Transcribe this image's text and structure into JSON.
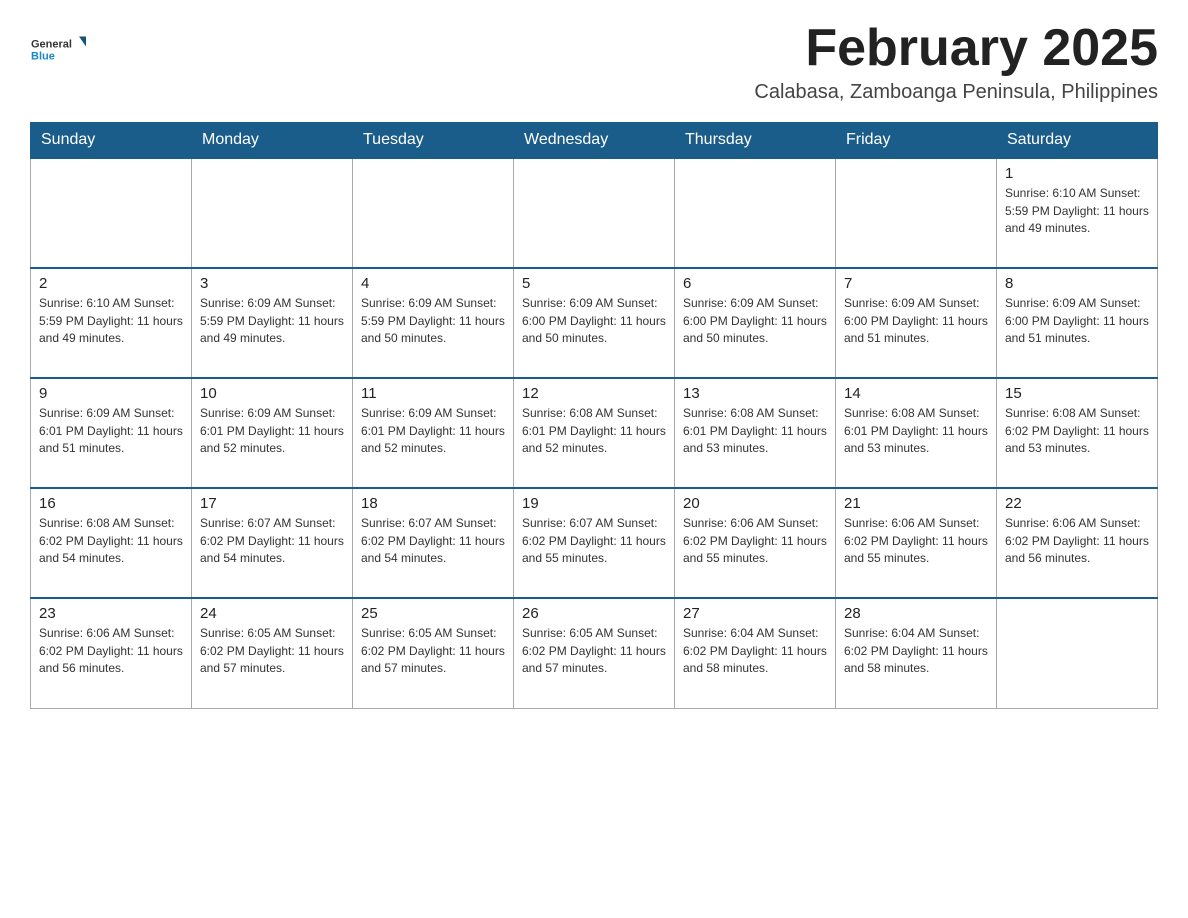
{
  "header": {
    "logo_general": "General",
    "logo_blue": "Blue",
    "title": "February 2025",
    "subtitle": "Calabasa, Zamboanga Peninsula, Philippines"
  },
  "calendar": {
    "days_of_week": [
      "Sunday",
      "Monday",
      "Tuesday",
      "Wednesday",
      "Thursday",
      "Friday",
      "Saturday"
    ],
    "weeks": [
      [
        {
          "day": "",
          "info": ""
        },
        {
          "day": "",
          "info": ""
        },
        {
          "day": "",
          "info": ""
        },
        {
          "day": "",
          "info": ""
        },
        {
          "day": "",
          "info": ""
        },
        {
          "day": "",
          "info": ""
        },
        {
          "day": "1",
          "info": "Sunrise: 6:10 AM\nSunset: 5:59 PM\nDaylight: 11 hours\nand 49 minutes."
        }
      ],
      [
        {
          "day": "2",
          "info": "Sunrise: 6:10 AM\nSunset: 5:59 PM\nDaylight: 11 hours\nand 49 minutes."
        },
        {
          "day": "3",
          "info": "Sunrise: 6:09 AM\nSunset: 5:59 PM\nDaylight: 11 hours\nand 49 minutes."
        },
        {
          "day": "4",
          "info": "Sunrise: 6:09 AM\nSunset: 5:59 PM\nDaylight: 11 hours\nand 50 minutes."
        },
        {
          "day": "5",
          "info": "Sunrise: 6:09 AM\nSunset: 6:00 PM\nDaylight: 11 hours\nand 50 minutes."
        },
        {
          "day": "6",
          "info": "Sunrise: 6:09 AM\nSunset: 6:00 PM\nDaylight: 11 hours\nand 50 minutes."
        },
        {
          "day": "7",
          "info": "Sunrise: 6:09 AM\nSunset: 6:00 PM\nDaylight: 11 hours\nand 51 minutes."
        },
        {
          "day": "8",
          "info": "Sunrise: 6:09 AM\nSunset: 6:00 PM\nDaylight: 11 hours\nand 51 minutes."
        }
      ],
      [
        {
          "day": "9",
          "info": "Sunrise: 6:09 AM\nSunset: 6:01 PM\nDaylight: 11 hours\nand 51 minutes."
        },
        {
          "day": "10",
          "info": "Sunrise: 6:09 AM\nSunset: 6:01 PM\nDaylight: 11 hours\nand 52 minutes."
        },
        {
          "day": "11",
          "info": "Sunrise: 6:09 AM\nSunset: 6:01 PM\nDaylight: 11 hours\nand 52 minutes."
        },
        {
          "day": "12",
          "info": "Sunrise: 6:08 AM\nSunset: 6:01 PM\nDaylight: 11 hours\nand 52 minutes."
        },
        {
          "day": "13",
          "info": "Sunrise: 6:08 AM\nSunset: 6:01 PM\nDaylight: 11 hours\nand 53 minutes."
        },
        {
          "day": "14",
          "info": "Sunrise: 6:08 AM\nSunset: 6:01 PM\nDaylight: 11 hours\nand 53 minutes."
        },
        {
          "day": "15",
          "info": "Sunrise: 6:08 AM\nSunset: 6:02 PM\nDaylight: 11 hours\nand 53 minutes."
        }
      ],
      [
        {
          "day": "16",
          "info": "Sunrise: 6:08 AM\nSunset: 6:02 PM\nDaylight: 11 hours\nand 54 minutes."
        },
        {
          "day": "17",
          "info": "Sunrise: 6:07 AM\nSunset: 6:02 PM\nDaylight: 11 hours\nand 54 minutes."
        },
        {
          "day": "18",
          "info": "Sunrise: 6:07 AM\nSunset: 6:02 PM\nDaylight: 11 hours\nand 54 minutes."
        },
        {
          "day": "19",
          "info": "Sunrise: 6:07 AM\nSunset: 6:02 PM\nDaylight: 11 hours\nand 55 minutes."
        },
        {
          "day": "20",
          "info": "Sunrise: 6:06 AM\nSunset: 6:02 PM\nDaylight: 11 hours\nand 55 minutes."
        },
        {
          "day": "21",
          "info": "Sunrise: 6:06 AM\nSunset: 6:02 PM\nDaylight: 11 hours\nand 55 minutes."
        },
        {
          "day": "22",
          "info": "Sunrise: 6:06 AM\nSunset: 6:02 PM\nDaylight: 11 hours\nand 56 minutes."
        }
      ],
      [
        {
          "day": "23",
          "info": "Sunrise: 6:06 AM\nSunset: 6:02 PM\nDaylight: 11 hours\nand 56 minutes."
        },
        {
          "day": "24",
          "info": "Sunrise: 6:05 AM\nSunset: 6:02 PM\nDaylight: 11 hours\nand 57 minutes."
        },
        {
          "day": "25",
          "info": "Sunrise: 6:05 AM\nSunset: 6:02 PM\nDaylight: 11 hours\nand 57 minutes."
        },
        {
          "day": "26",
          "info": "Sunrise: 6:05 AM\nSunset: 6:02 PM\nDaylight: 11 hours\nand 57 minutes."
        },
        {
          "day": "27",
          "info": "Sunrise: 6:04 AM\nSunset: 6:02 PM\nDaylight: 11 hours\nand 58 minutes."
        },
        {
          "day": "28",
          "info": "Sunrise: 6:04 AM\nSunset: 6:02 PM\nDaylight: 11 hours\nand 58 minutes."
        },
        {
          "day": "",
          "info": ""
        }
      ]
    ]
  }
}
